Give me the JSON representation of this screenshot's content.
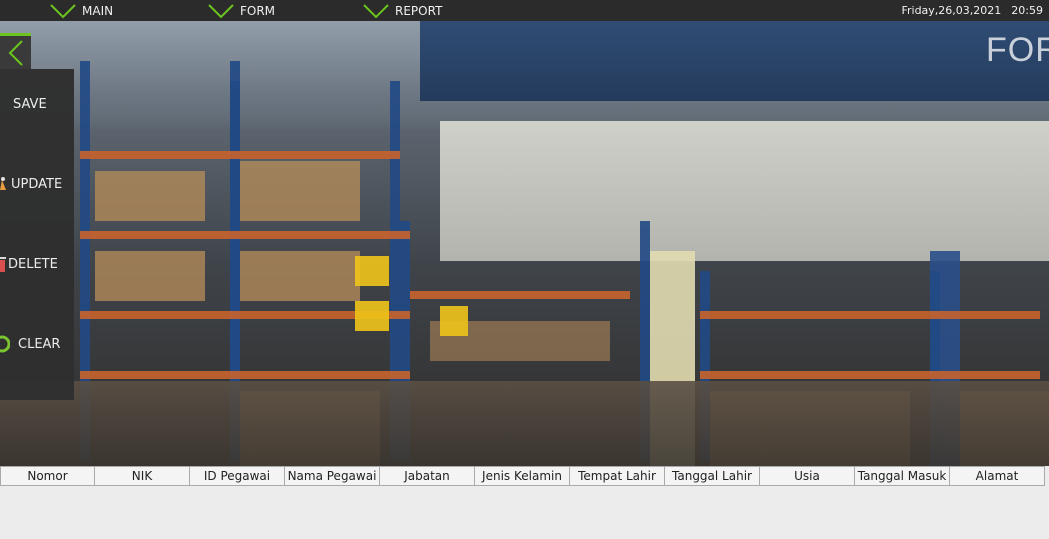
{
  "menu": {
    "main_label": "MAIN",
    "form_label": "FORM",
    "report_label": "REPORT"
  },
  "clock": {
    "date": "Friday,26,03,2021",
    "time": "20:59"
  },
  "header": {
    "title": "FOR"
  },
  "side_panel": {
    "save_label": "SAVE",
    "update_label": "UPDATE",
    "delete_label": "DELETE",
    "clear_label": "CLEAR"
  },
  "table": {
    "columns": [
      "Nomor",
      "NIK",
      "ID Pegawai",
      "Nama Pegawai",
      "Jabatan",
      "Jenis Kelamin",
      "Tempat Lahir",
      "Tanggal Lahir",
      "Usia",
      "Tanggal Masuk",
      "Alamat"
    ]
  },
  "colors": {
    "accent": "#6cc41e",
    "topbar": "#2b2b2b",
    "panel": "#2f2f2f"
  },
  "icons": {
    "menu": "chevron-down-icon",
    "back": "chevron-left-icon",
    "update": "update-icon",
    "delete": "delete-icon",
    "clear": "clear-icon"
  }
}
